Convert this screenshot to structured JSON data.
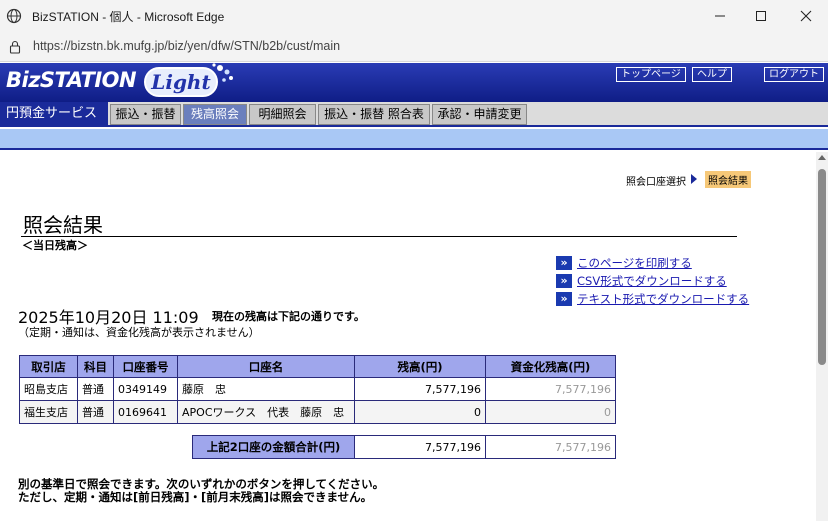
{
  "browser": {
    "window_title": "BizSTATION - 個人 - Microsoft Edge",
    "url": "https://bizstn.bk.mufg.jp/biz/yen/dfw/STN/b2b/cust/main",
    "icons": [
      "globe-icon",
      "lock-icon",
      "minimize-icon",
      "maximize-icon",
      "close-icon"
    ]
  },
  "header": {
    "logo_text": "BizSTATION",
    "logo_light": "Light",
    "top_links": [
      "トップページ",
      "ヘルプ",
      "ログアウト"
    ]
  },
  "nav": {
    "service": "円預金サービス",
    "tabs": [
      "振込・振替",
      "残高照会",
      "明細照会",
      "振込・振替 照合表",
      "承認・申請変更"
    ],
    "active_tab": "残高照会"
  },
  "breadcrumb": {
    "step1": "照会口座選択",
    "current": "照会結果"
  },
  "page": {
    "title": "照会結果",
    "subtitle": "＜当日残高＞"
  },
  "links": [
    "このページを印刷する",
    "CSV形式でダウンロードする",
    "テキスト形式でダウンロードする"
  ],
  "balance_info": {
    "datetime": "2025年10月20日 11:09",
    "note": "現在の残高は下記の通りです。",
    "subnote": "（定期・通知は、資金化残高が表示されません）"
  },
  "table": {
    "headers": [
      "取引店",
      "科目",
      "口座番号",
      "口座名",
      "残高(円)",
      "資金化残高(円)"
    ],
    "rows": [
      [
        "昭島支店",
        "普通",
        "0349149",
        "藤原　忠",
        "7,577,196",
        "7,577,196"
      ],
      [
        "福生支店",
        "普通",
        "0169641",
        "APOCワークス　代表　藤原　忠",
        "0",
        "0"
      ]
    ]
  },
  "total": {
    "label": "上記2口座の金額合計(円)",
    "balance": "7,577,196",
    "available": "7,577,196"
  },
  "footnote": {
    "line1": "別の基準日で照会できます。次のいずれかのボタンを押してください。",
    "line2": "ただし、定期・通知は[前日残高]・[前月末残高]は照会できません。"
  },
  "colors": {
    "brand_blue": "#1a2a9a",
    "header_blue": "#9fa6ec",
    "strip_blue": "#a9c8f5",
    "crumb_highlight": "#f6c878"
  }
}
